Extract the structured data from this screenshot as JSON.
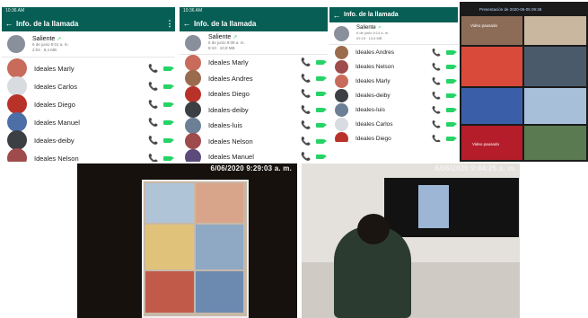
{
  "screenshots": [
    {
      "status_time": "10:36 AM",
      "title": "Info. de la llamada",
      "outgoing_label": "Saliente",
      "outgoing_date": "6 de junio 9:01 a. m.",
      "outgoing_size": "2:04 · 8,4 MB",
      "contacts": [
        "Ideales Marly",
        "Ideales Carlos",
        "Ideales Diego",
        "Ideales Manuel",
        "Ideales-deiby",
        "Ideales Nelson"
      ]
    },
    {
      "status_time": "10:36 AM",
      "title": "Info. de la llamada",
      "outgoing_label": "Saliente",
      "outgoing_date": "6 de junio 9:09 a. m.",
      "outgoing_size": "8:10 · 10,9 MB",
      "contacts": [
        "Ideales Marly",
        "Ideales Andres",
        "Ideales Diego",
        "Ideales-deiby",
        "Ideales-luis",
        "Ideales Nelson",
        "Ideales Manuel"
      ]
    },
    {
      "title": "Info. de la llamada",
      "outgoing_label": "Saliente",
      "outgoing_date": "6 de junio 9:14 a. m.",
      "outgoing_size": "02:15 · 13,5 MB",
      "contacts": [
        "Ideales Andres",
        "Ideales Nelson",
        "Ideales Marly",
        "Ideales-deiby",
        "Ideales-luis",
        "Ideales Carlos",
        "Ideales Diego"
      ]
    }
  ],
  "video_grid": {
    "top_caption": "Presentación de 2020-06-05 09:48",
    "tile_captions": [
      "Video pausado",
      "Video pausado"
    ]
  },
  "photos": {
    "left_timestamp": "6/06/2020 9:29:03 a. m.",
    "right_timestamp": "6/06/2020 9:44:25 a. m."
  },
  "icons": {
    "back": "arrow-left-icon",
    "more": "more-vert-icon",
    "call": "phone-icon",
    "video": "videocam-icon",
    "outgoing": "call-made-icon"
  },
  "colors": {
    "whatsapp_bar": "#075e54",
    "whatsapp_accent": "#25d366"
  }
}
